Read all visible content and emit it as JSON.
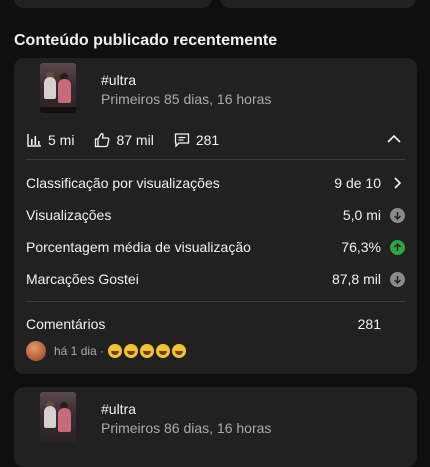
{
  "section": {
    "title": "Conteúdo publicado recentemente"
  },
  "videos": [
    {
      "title": "#ultra",
      "subtitle": "Primeiros 85 dias, 16 horas",
      "stats": {
        "views": "5 mi",
        "likes": "87 mil",
        "comments": "281"
      },
      "metrics": [
        {
          "label": "Classificação por visualizações",
          "value": "9 de 10",
          "icon": "chevron-right-icon"
        },
        {
          "label": "Visualizações",
          "value": "5,0 mi",
          "icon": "arrow-down-circle-icon",
          "trend_color": "#8a8a8a"
        },
        {
          "label": "Porcentagem média de visualização",
          "value": "76,3%",
          "icon": "arrow-up-circle-icon",
          "trend_color": "#2ba640"
        },
        {
          "label": "Marcações Gostei",
          "value": "87,8 mil",
          "icon": "arrow-down-circle-icon",
          "trend_color": "#8a8a8a"
        }
      ],
      "comments_section": {
        "label": "Comentários",
        "count": "281",
        "preview_time": "há 1 dia ·",
        "emoji_count": 5
      }
    },
    {
      "title": "#ultra",
      "subtitle": "Primeiros 86 dias, 16 horas"
    }
  ]
}
